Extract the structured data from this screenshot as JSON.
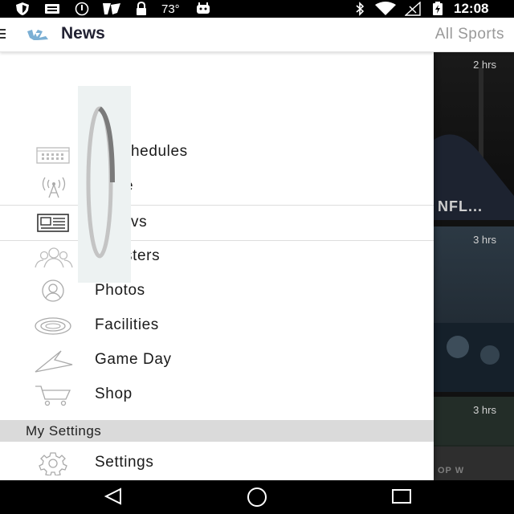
{
  "status_bar": {
    "temperature": "73°",
    "time": "12:08",
    "icons": [
      "shield-icon",
      "message-icon",
      "alarm-icon",
      "fox-sports-icon",
      "lock-icon",
      "android-icon",
      "bluetooth-icon",
      "wifi-icon",
      "no-signal-icon",
      "battery-charging-icon"
    ]
  },
  "toolbar": {
    "title": "News",
    "filter": "All Sports",
    "logo_icon": "unc-logo-icon",
    "menu_icon": "hamburger-menu-icon"
  },
  "drawer": {
    "items": [
      {
        "label": "Schedules",
        "icon": "calendar-icon"
      },
      {
        "label": "Live",
        "icon": "broadcast-icon"
      },
      {
        "label": "News",
        "icon": "newspaper-icon",
        "active": true
      },
      {
        "label": "Rosters",
        "icon": "team-icon"
      },
      {
        "label": "Photos",
        "icon": "camera-icon"
      },
      {
        "label": "Facilities",
        "icon": "stadium-icon"
      },
      {
        "label": "Game Day",
        "icon": "pennant-icon"
      },
      {
        "label": "Shop",
        "icon": "cart-icon"
      }
    ],
    "visible_labels": [
      "hedules",
      "e",
      "vs",
      "sters"
    ],
    "section_header": "My Settings",
    "settings_item": {
      "label": "Settings",
      "icon": "gear-icon"
    }
  },
  "background_cards": [
    {
      "time": "2 hrs",
      "headline": "NFL..."
    },
    {
      "time": "3 hrs",
      "headline": ""
    },
    {
      "time": "3 hrs",
      "headline": "OP W"
    }
  ],
  "loading": {
    "icon": "spinner-icon"
  },
  "nav_bar": {
    "icons": [
      "back-icon",
      "home-icon",
      "recents-icon"
    ]
  },
  "colors": {
    "accent": "#7bafd4",
    "header_bg": "#dadada",
    "status_bg": "#000000"
  }
}
